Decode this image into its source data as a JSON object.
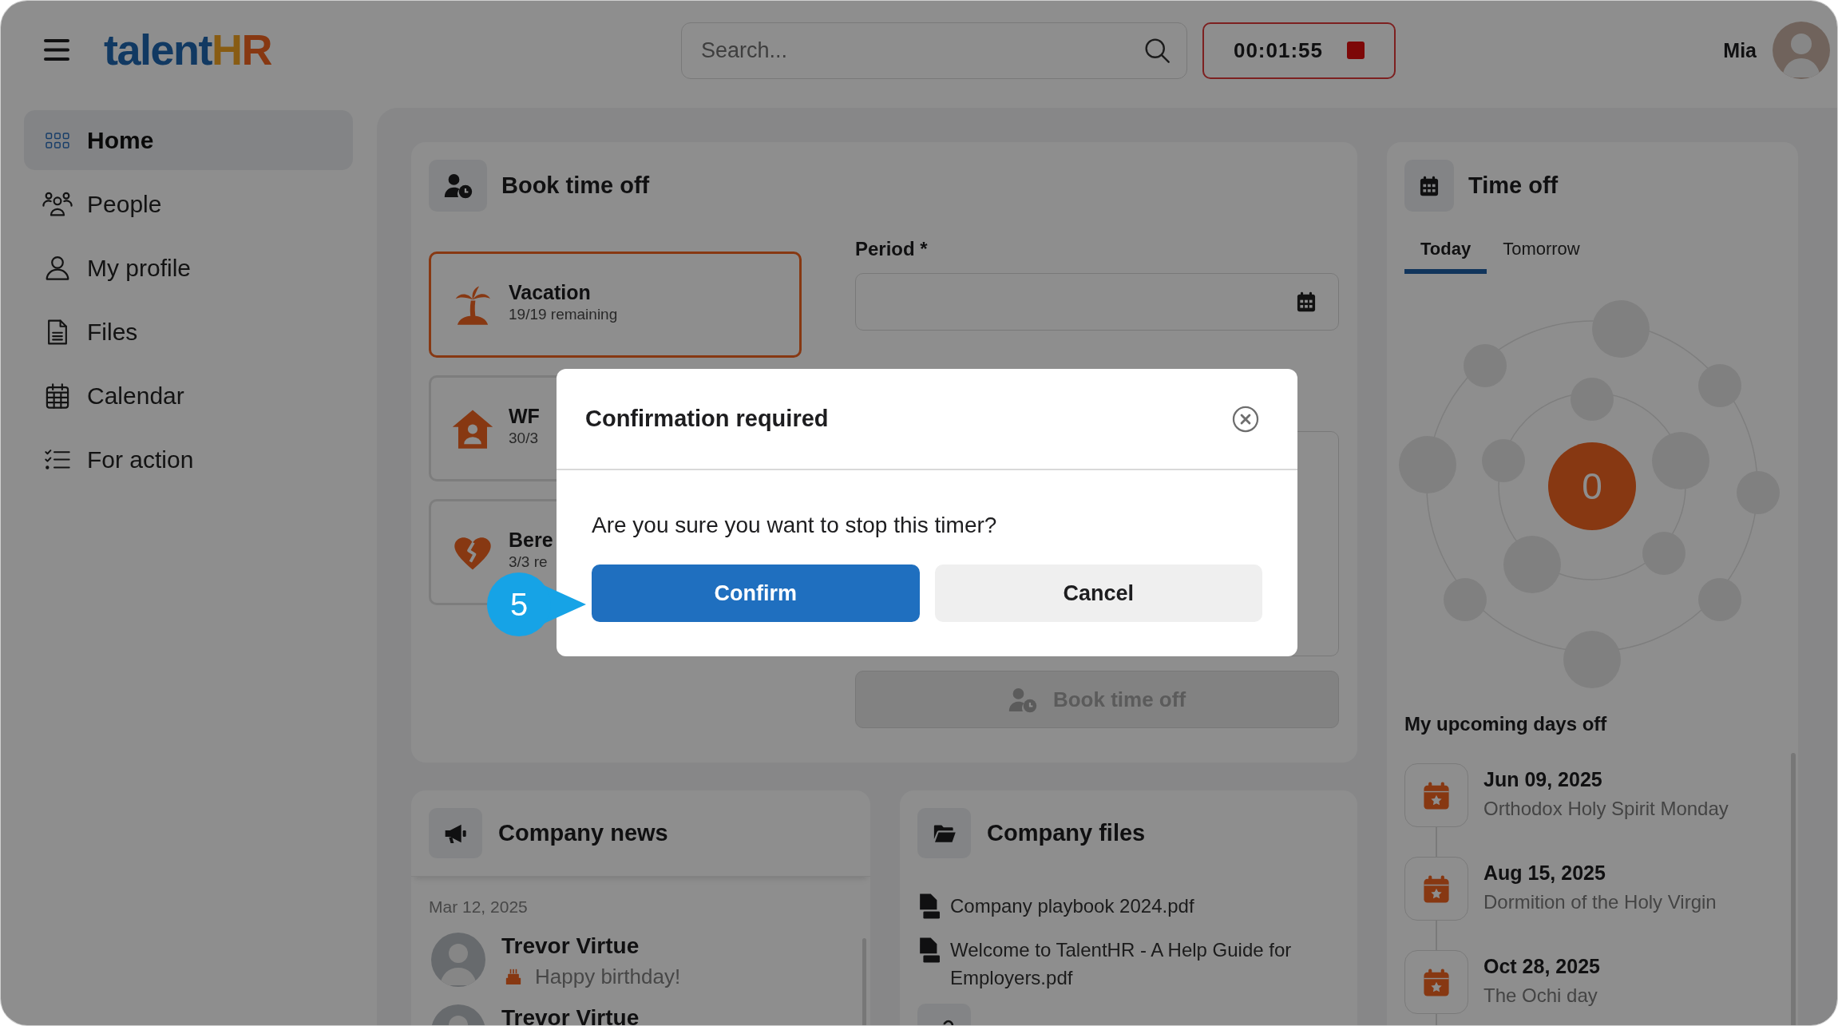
{
  "app_bar": {
    "logo": {
      "text": "talent",
      "accent": "HR"
    },
    "search": {
      "placeholder": "Search..."
    },
    "timer": {
      "time": "00:01:55"
    },
    "user": {
      "name": "Mia"
    }
  },
  "sidebar": {
    "items": [
      {
        "label": "Home",
        "selected": true
      },
      {
        "label": "People",
        "selected": false
      },
      {
        "label": "My profile",
        "selected": false
      },
      {
        "label": "Files",
        "selected": false
      },
      {
        "label": "Calendar",
        "selected": false
      },
      {
        "label": "For action",
        "selected": false
      }
    ]
  },
  "book_time_off": {
    "title": "Book time off",
    "leave_types": [
      {
        "name": "Vacation",
        "remaining": "19/19 remaining",
        "selected": true
      },
      {
        "name": "WF",
        "remaining": "30/3",
        "selected": false
      },
      {
        "name": "Bere",
        "remaining": "3/3 re",
        "selected": false
      }
    ],
    "period": {
      "label": "Period *"
    },
    "submit": {
      "label": "Book time off",
      "disabled": true
    }
  },
  "time_off": {
    "title": "Time off",
    "tabs": [
      {
        "label": "Today",
        "selected": true
      },
      {
        "label": "Tomorrow",
        "selected": false
      }
    ],
    "count": "0",
    "upcoming": {
      "title": "My upcoming days off",
      "items": [
        {
          "date": "Jun 09, 2025",
          "name": "Orthodox Holy Spirit Monday"
        },
        {
          "date": "Aug 15, 2025",
          "name": "Dormition of the Holy Virgin"
        },
        {
          "date": "Oct 28, 2025",
          "name": "The Ochi day"
        }
      ]
    }
  },
  "company_news": {
    "title": "Company news",
    "date": "Mar 12, 2025",
    "posts": [
      {
        "author": "Trevor Virtue",
        "message": "Happy birthday!"
      },
      {
        "author": "Trevor Virtue"
      }
    ]
  },
  "company_files": {
    "title": "Company files",
    "files": [
      "Company playbook 2024.pdf",
      "Welcome to TalentHR - A Help Guide for Employers.pdf"
    ]
  },
  "dialog": {
    "title": "Confirmation required",
    "message": "Are you sure you want to stop this timer?",
    "buttons": [
      {
        "label": "Confirm",
        "kind": "primary"
      },
      {
        "label": "Cancel",
        "kind": "secondary"
      }
    ]
  },
  "step_marker": {
    "number": "5"
  }
}
